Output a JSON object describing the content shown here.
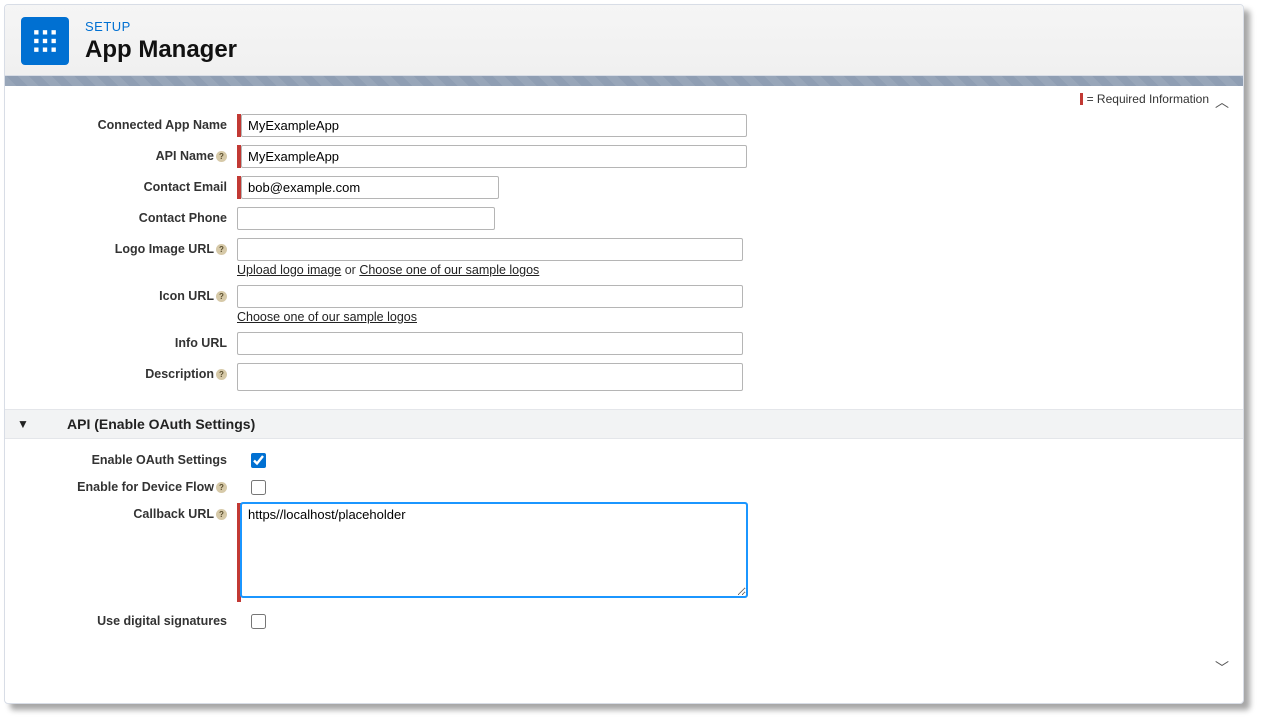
{
  "header": {
    "eyebrow": "SETUP",
    "title": "App Manager"
  },
  "legend": {
    "text": "= Required Information"
  },
  "form": {
    "connected_app_name": {
      "label": "Connected App Name",
      "value": "MyExampleApp",
      "required": true
    },
    "api_name": {
      "label": "API Name",
      "value": "MyExampleApp",
      "required": true
    },
    "contact_email": {
      "label": "Contact Email",
      "value": "bob@example.com",
      "required": true
    },
    "contact_phone": {
      "label": "Contact Phone",
      "value": ""
    },
    "logo_image_url": {
      "label": "Logo Image URL",
      "value": "",
      "hint_prefix": "Upload logo image",
      "hint_mid": " or ",
      "hint_suffix": "Choose one of our sample logos"
    },
    "icon_url": {
      "label": "Icon URL",
      "value": "",
      "hint": "Choose one of our sample logos"
    },
    "info_url": {
      "label": "Info URL",
      "value": ""
    },
    "description": {
      "label": "Description",
      "value": ""
    }
  },
  "section": {
    "title": "API (Enable OAuth Settings)"
  },
  "oauth": {
    "enable_oauth": {
      "label": "Enable OAuth Settings",
      "checked": true
    },
    "enable_device_flow": {
      "label": "Enable for Device Flow",
      "checked": false
    },
    "callback_url": {
      "label": "Callback URL",
      "value": "https//localhost/placeholder",
      "required": true
    },
    "use_digital_signatures": {
      "label": "Use digital signatures",
      "checked": false
    }
  }
}
